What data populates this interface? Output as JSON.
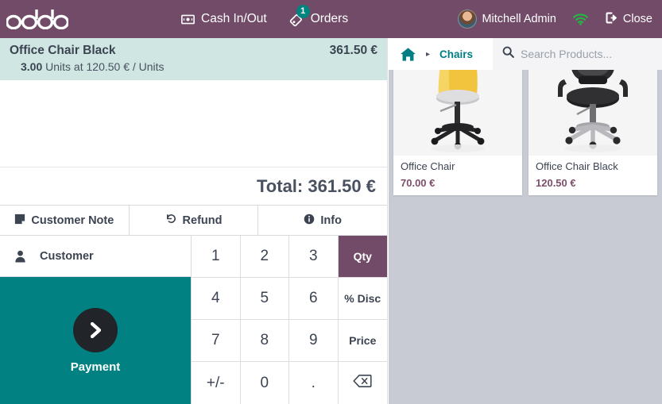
{
  "topbar": {
    "logo": "odoo",
    "cash_in_out": {
      "label": "Cash In/Out",
      "icon": "banknote-icon"
    },
    "orders": {
      "label": "Orders",
      "icon": "ticket-icon",
      "badge": "1"
    },
    "user": {
      "name": "Mitchell Admin",
      "icon": "avatar"
    },
    "wifi": {
      "icon": "wifi-icon",
      "color": "#1ebd42"
    },
    "close": {
      "label": "Close",
      "icon": "exit-icon"
    },
    "background": "#714b67"
  },
  "order": {
    "lines": [
      {
        "product": "Office Chair Black",
        "line_total": "361.50 €",
        "qty": "3.00",
        "unit_text": "Units at 120.50 € / Units",
        "selected": true
      }
    ],
    "total_label": "Total: 361.50 €",
    "selected_bg": "#cfe6e2"
  },
  "actions": [
    {
      "label": "Customer Note",
      "icon": "note-icon"
    },
    {
      "label": "Refund",
      "icon": "refund-icon"
    },
    {
      "label": "Info",
      "icon": "info-icon"
    }
  ],
  "customer": {
    "label": "Customer",
    "icon": "person-icon"
  },
  "payment": {
    "label": "Payment",
    "icon": "chevron-right-icon",
    "background": "#018182"
  },
  "numpad": {
    "keys": [
      {
        "label": "1",
        "name": "key-1",
        "active": false
      },
      {
        "label": "2",
        "name": "key-2",
        "active": false
      },
      {
        "label": "3",
        "name": "key-3",
        "active": false
      },
      {
        "label": "Qty",
        "name": "key-qty",
        "active": true
      },
      {
        "label": "4",
        "name": "key-4",
        "active": false
      },
      {
        "label": "5",
        "name": "key-5",
        "active": false
      },
      {
        "label": "6",
        "name": "key-6",
        "active": false
      },
      {
        "label": "% Disc",
        "name": "key-discount",
        "active": false
      },
      {
        "label": "7",
        "name": "key-7",
        "active": false
      },
      {
        "label": "8",
        "name": "key-8",
        "active": false
      },
      {
        "label": "9",
        "name": "key-9",
        "active": false
      },
      {
        "label": "Price",
        "name": "key-price",
        "active": false
      },
      {
        "label": "+/-",
        "name": "key-sign",
        "active": false
      },
      {
        "label": "0",
        "name": "key-0",
        "active": false
      },
      {
        "label": ".",
        "name": "key-decimal",
        "active": false
      },
      {
        "label": "",
        "name": "key-backspace",
        "active": false
      }
    ],
    "active_color": "#714b67"
  },
  "products_panel": {
    "breadcrumb": {
      "home_icon": "home-icon",
      "arrow": "▸",
      "category": "Chairs"
    },
    "search": {
      "placeholder": "Search Products...",
      "value": "",
      "icon": "search-icon"
    },
    "background": "#c8cbd3",
    "items": [
      {
        "name": "Office Chair",
        "price": "70.00 €",
        "image": "yellow-office-chair"
      },
      {
        "name": "Office Chair Black",
        "price": "120.50 €",
        "image": "black-office-chair"
      }
    ]
  }
}
